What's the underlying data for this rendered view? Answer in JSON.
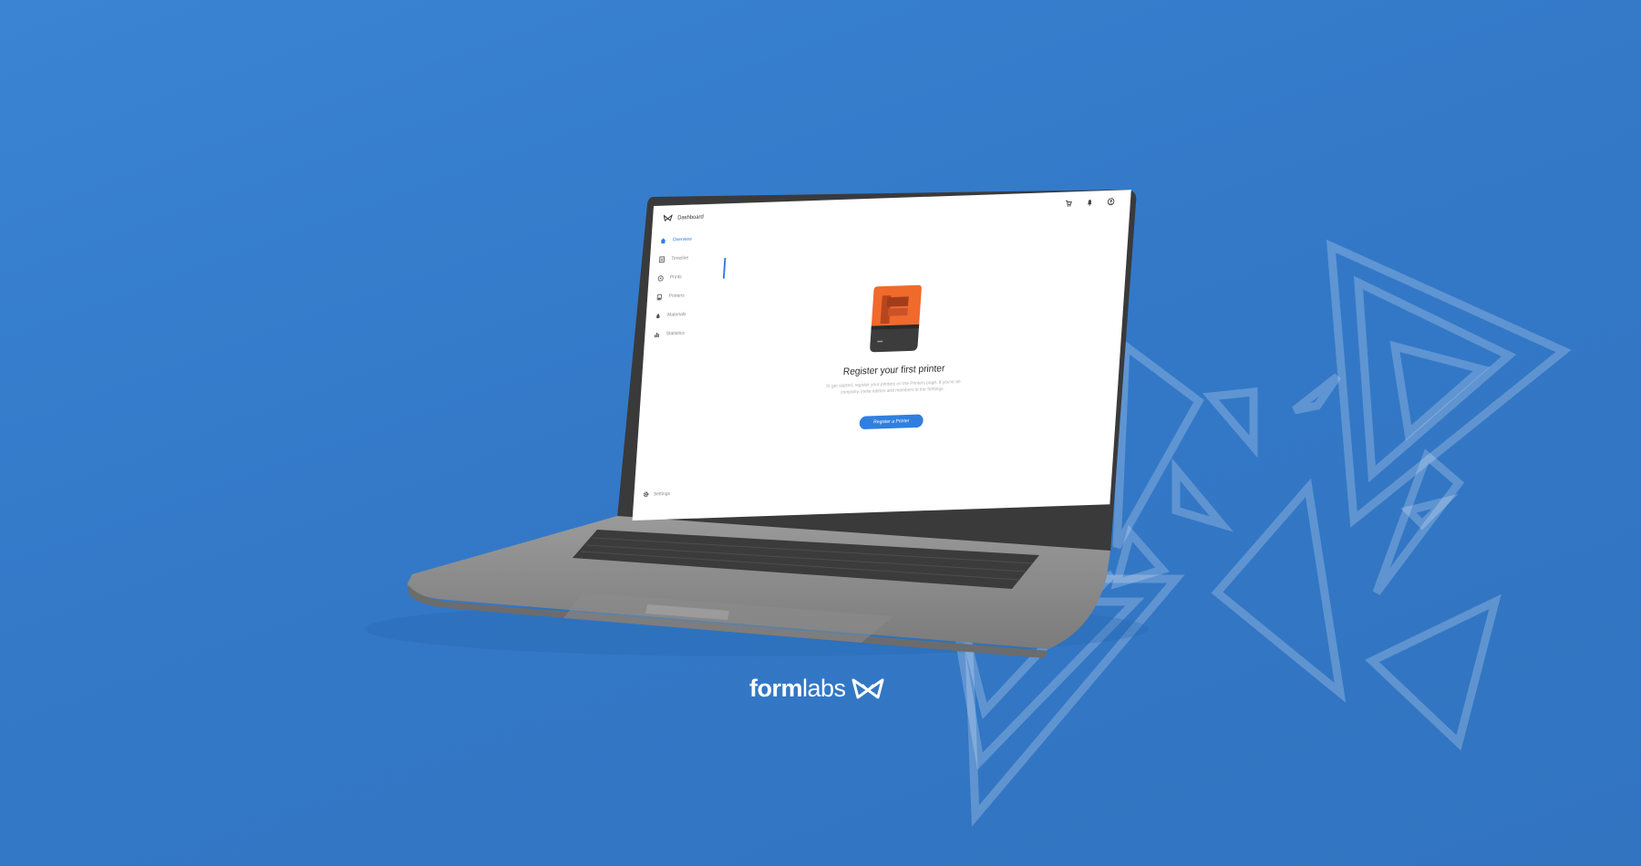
{
  "app": {
    "title": "Dashboard"
  },
  "sidebar": {
    "items": [
      {
        "label": "Overview",
        "icon": "home-icon",
        "active": true
      },
      {
        "label": "Timeline",
        "icon": "timeline-icon",
        "active": false
      },
      {
        "label": "Prints",
        "icon": "prints-icon",
        "active": false
      },
      {
        "label": "Printers",
        "icon": "printer-icon",
        "active": false
      },
      {
        "label": "Materials",
        "icon": "resin-drop-icon",
        "active": false
      },
      {
        "label": "Statistics",
        "icon": "bar-chart-icon",
        "active": false
      }
    ],
    "settings_label": "Settings"
  },
  "header_icons": [
    "cart-icon",
    "bell-icon",
    "account-icon"
  ],
  "main": {
    "title": "Register your first printer",
    "description": "To get started, register your printers on the Printers page. If you're an company, invite editors and members in the Settings.",
    "cta_label": "Register a Printer"
  },
  "brand": {
    "logo_bold": "form",
    "logo_light": "labs"
  },
  "colors": {
    "background": "#3a84d3",
    "accent": "#2f7fe0",
    "printer_orange": "#f05a28"
  }
}
